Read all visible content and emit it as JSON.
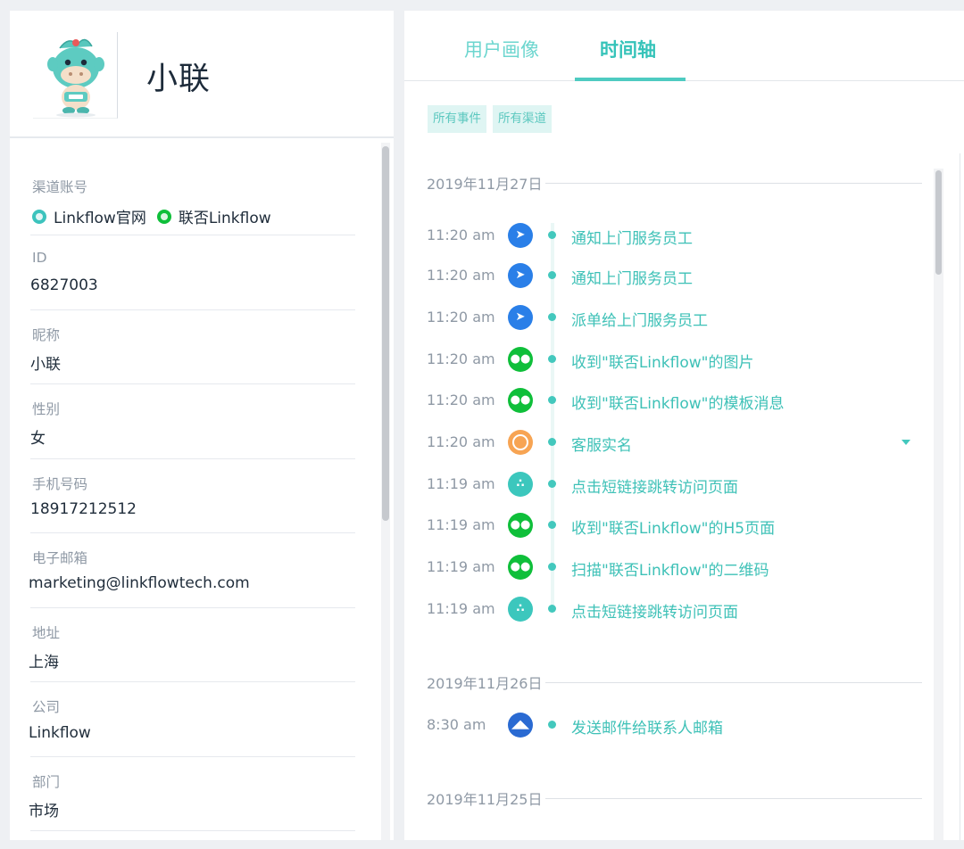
{
  "profile": {
    "name": "小联"
  },
  "fields": {
    "channel": {
      "label": "渠道账号",
      "accounts": [
        "Linkflow官网",
        "联否Linkflow"
      ]
    },
    "id": {
      "label": "ID",
      "value": "6827003"
    },
    "nickname": {
      "label": "昵称",
      "value": "小联"
    },
    "gender": {
      "label": "性别",
      "value": "女"
    },
    "phone": {
      "label": "手机号码",
      "value": "18917212512"
    },
    "email": {
      "label": "电子邮箱",
      "value": "marketing@linkflowtech.com"
    },
    "address": {
      "label": "地址",
      "value": "上海"
    },
    "company": {
      "label": "公司",
      "value": "Linkflow"
    },
    "department": {
      "label": "部门",
      "value": "市场"
    }
  },
  "tabs": {
    "profile": "用户画像",
    "timeline": "时间轴"
  },
  "filters": {
    "events": "所有事件",
    "channels": "所有渠道"
  },
  "timeline": {
    "groups": [
      {
        "date": "2019年11月27日",
        "events": [
          {
            "time": "11:20 am",
            "icon": "telegram-icon",
            "title": "通知上门服务员工"
          },
          {
            "time": "11:20 am",
            "icon": "telegram-icon",
            "title": "通知上门服务员工"
          },
          {
            "time": "11:20 am",
            "icon": "telegram-icon",
            "title": "派单给上门服务员工"
          },
          {
            "time": "11:20 am",
            "icon": "wechat-icon",
            "title": "收到\"联否Linkflow\"的图片"
          },
          {
            "time": "11:20 am",
            "icon": "wechat-icon",
            "title": "收到\"联否Linkflow\"的模板消息"
          },
          {
            "time": "11:20 am",
            "icon": "customer-service-icon",
            "title": "客服实名"
          },
          {
            "time": "11:19 am",
            "icon": "linkflow-icon",
            "title": "点击短链接跳转访问页面"
          },
          {
            "time": "11:19 am",
            "icon": "wechat-icon",
            "title": "收到\"联否Linkflow\"的H5页面"
          },
          {
            "time": "11:19 am",
            "icon": "wechat-icon",
            "title": "扫描\"联否Linkflow\"的二维码"
          },
          {
            "time": "11:19 am",
            "icon": "linkflow-icon",
            "title": "点击短链接跳转访问页面"
          }
        ]
      },
      {
        "date": "2019年11月26日",
        "events": [
          {
            "time": "8:30 am",
            "icon": "mail-icon",
            "title": "发送邮件给联系人邮箱"
          }
        ]
      },
      {
        "date": "2019年11月25日",
        "events": []
      }
    ]
  },
  "colors": {
    "accent": "#43c8bd",
    "telegram": "#2a7fe8",
    "wechat": "#0fbf3a",
    "service": "#f7a453"
  }
}
